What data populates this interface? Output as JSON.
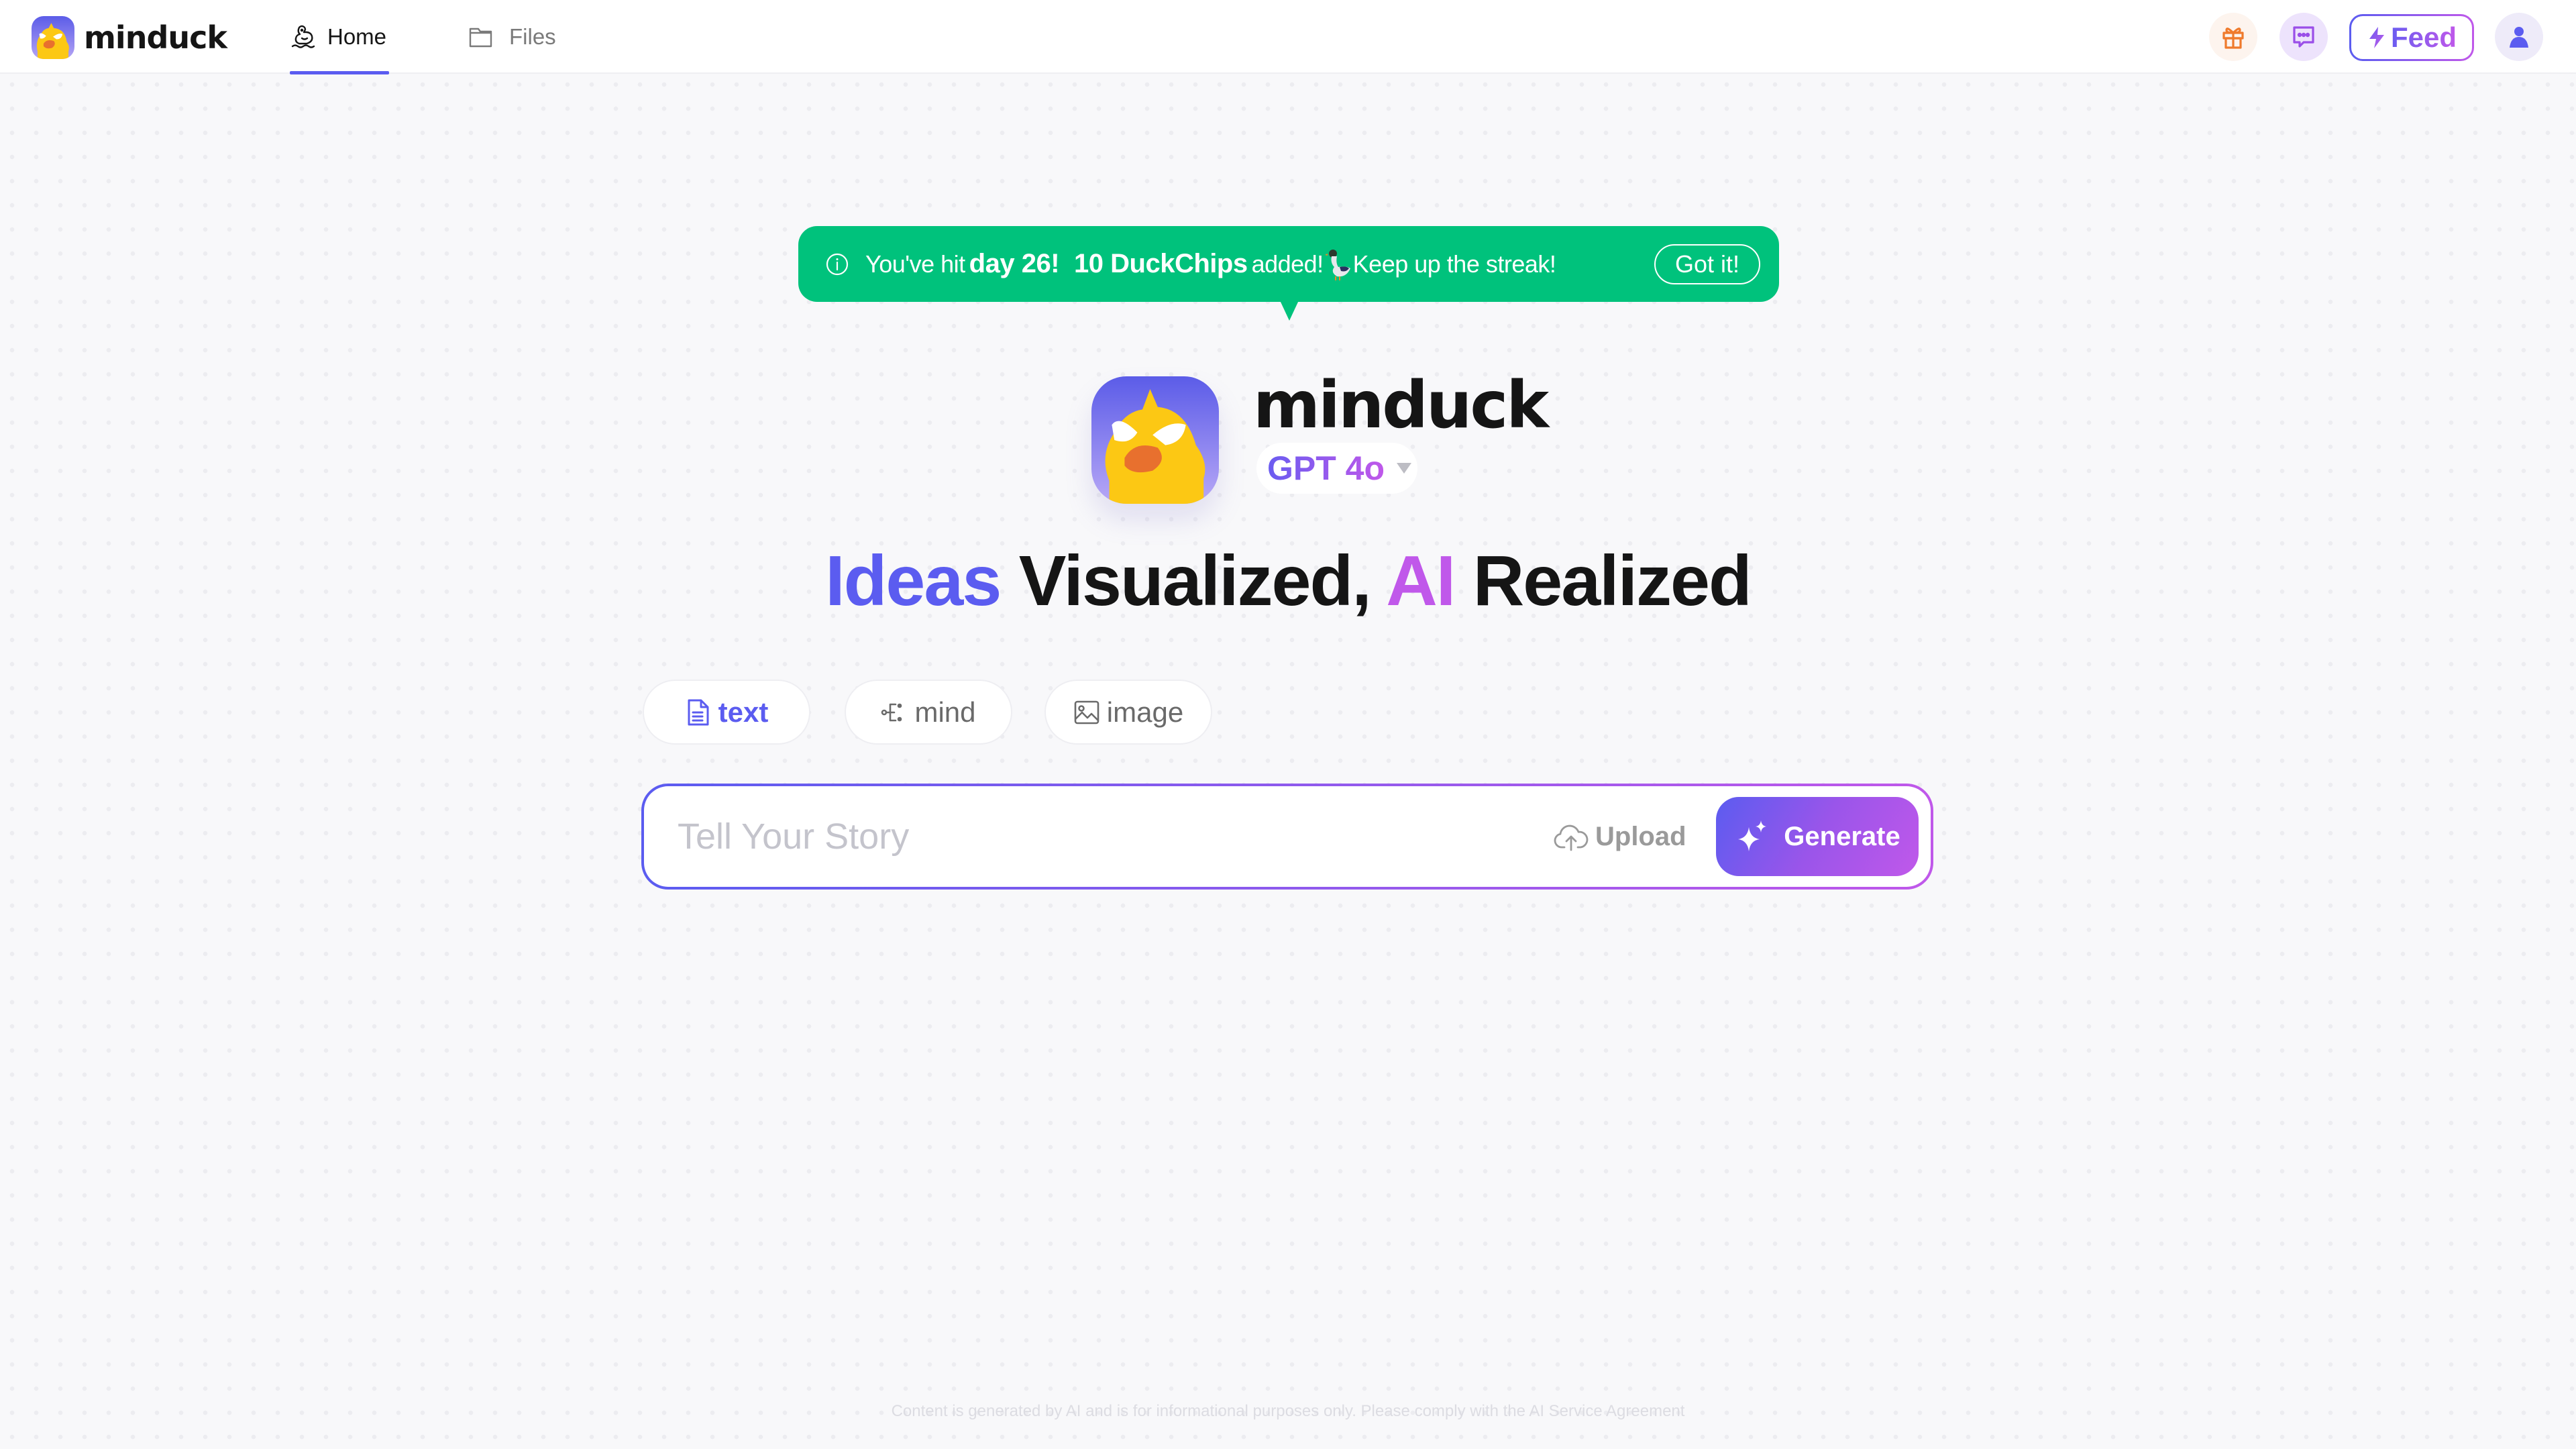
{
  "header": {
    "brand_name": "minduck",
    "nav": [
      {
        "label": "Home",
        "icon": "duck-icon",
        "active": true
      },
      {
        "label": "Files",
        "icon": "folder-icon",
        "active": false
      }
    ],
    "actions": {
      "gift_icon": "gift-icon",
      "chat_icon": "chat-bubble-icon",
      "feed_label": "Feed",
      "feed_icon": "lightning-icon",
      "avatar_icon": "user-icon"
    },
    "accent_color": "#5b5cf0"
  },
  "banner": {
    "icon": "info-icon",
    "text_prefix": "You've hit",
    "day_text": "day 26!",
    "chips_text": "10 DuckChips",
    "added_text": "added!",
    "emoji": "duck-emoji",
    "streak_text": "Keep up the streak!",
    "button_label": "Got it!",
    "color": "#00c27c"
  },
  "hero": {
    "brand_name": "minduck",
    "model": "GPT 4o",
    "headline": {
      "part1": "Ideas",
      "part2": "Visualized,",
      "part3": "AI",
      "part4": "Realized"
    },
    "colors": {
      "primary": "#5b5cf0",
      "secondary": "#c058ea"
    }
  },
  "modes": [
    {
      "label": "text",
      "icon": "document-icon",
      "active": true
    },
    {
      "label": "mind",
      "icon": "mindmap-icon",
      "active": false
    },
    {
      "label": "image",
      "icon": "image-icon",
      "active": false
    }
  ],
  "prompt": {
    "value": "",
    "placeholder": "Tell Your Story",
    "upload_label": "Upload",
    "generate_label": "Generate"
  },
  "footer": {
    "note": "Content is generated by AI and is for informational purposes only. Please comply with the AI Service Agreement"
  }
}
